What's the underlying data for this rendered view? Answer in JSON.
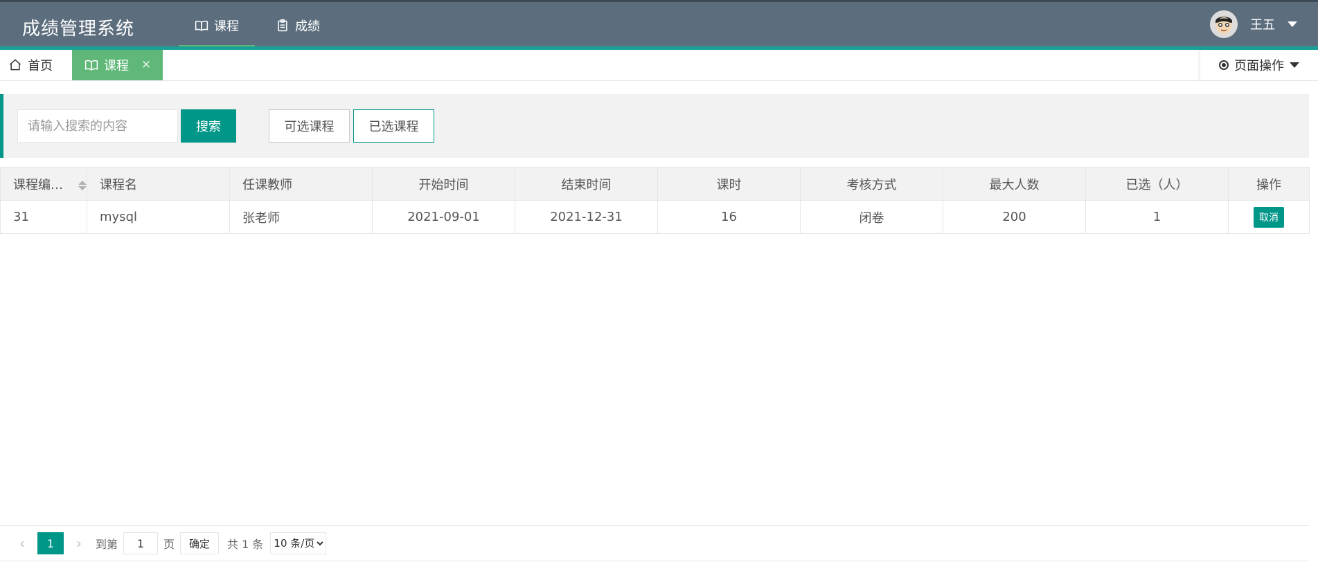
{
  "header": {
    "title": "成绩管理系统",
    "nav": [
      {
        "label": "课程",
        "icon": "book-icon"
      },
      {
        "label": "成绩",
        "icon": "clipboard-icon"
      }
    ],
    "user": {
      "name": "王五"
    }
  },
  "tabs": {
    "home_label": "首页",
    "course_label": "课程",
    "close_glyph": "✕",
    "page_ops_label": "页面操作"
  },
  "toolbar": {
    "search_placeholder": "请输入搜索的内容",
    "search_button": "搜索",
    "available_button": "可选课程",
    "selected_button": "已选课程"
  },
  "table": {
    "columns": [
      "课程编号…",
      "课程名",
      "任课教师",
      "开始时间",
      "结束时间",
      "课时",
      "考核方式",
      "最大人数",
      "已选（人）",
      "操作"
    ],
    "rows": [
      {
        "id": "31",
        "name": "mysql",
        "teacher": "张老师",
        "start": "2021-09-01",
        "end": "2021-12-31",
        "hours": "16",
        "exam": "闭卷",
        "max": "200",
        "chosen": "1",
        "action": "取消"
      }
    ]
  },
  "pager": {
    "current_page": "1",
    "goto_label": "到第",
    "goto_value": "1",
    "page_label": "页",
    "confirm_label": "确定",
    "total_label": "共 1 条",
    "page_size": "10 条/页"
  },
  "colors": {
    "header_bg": "#5c6e7e",
    "accent": "#009688",
    "tab_active": "#5fb878"
  }
}
